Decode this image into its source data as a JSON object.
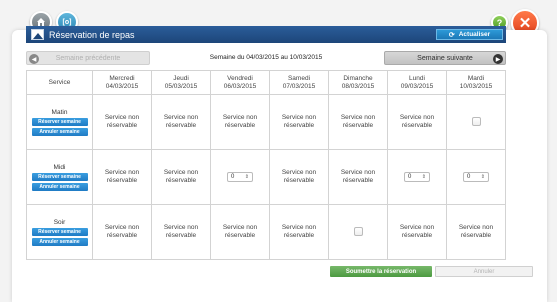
{
  "top_buttons": {
    "home_icon": "home-icon",
    "calendar_icon": "calendar-icon",
    "calendar_label": "[o]",
    "help_label": "?",
    "close_label": "✕"
  },
  "header": {
    "title": "Réservation de repas",
    "refresh_label": "Actualiser",
    "refresh_icon": "⟳"
  },
  "week_nav": {
    "prev_label": "Semaine précédente",
    "prev_arrow": "◀",
    "range_label": "Semaine du 04/03/2015 au 10/03/2015",
    "next_label": "Semaine suivante",
    "next_arrow": "▶"
  },
  "table": {
    "service_header": "Service",
    "days": [
      {
        "name": "Mercredi",
        "date": "04/03/2015"
      },
      {
        "name": "Jeudi",
        "date": "05/03/2015"
      },
      {
        "name": "Vendredi",
        "date": "06/03/2015"
      },
      {
        "name": "Samedi",
        "date": "07/03/2015"
      },
      {
        "name": "Dimanche",
        "date": "08/03/2015"
      },
      {
        "name": "Lundi",
        "date": "09/03/2015"
      },
      {
        "name": "Mardi",
        "date": "10/03/2015"
      }
    ],
    "reserve_week_label": "Réserver semaine",
    "cancel_week_label": "Annuler semaine",
    "nonres_line1": "Service non",
    "nonres_line2": "réservable",
    "spin_value": "0",
    "spin_arrows": "⇕",
    "rows": [
      {
        "label": "Matin",
        "cells": [
          "nonres",
          "nonres",
          "nonres",
          "nonres",
          "nonres",
          "nonres",
          "checkbox"
        ]
      },
      {
        "label": "Midi",
        "cells": [
          "nonres",
          "nonres",
          "spin",
          "nonres",
          "nonres",
          "spin",
          "spin"
        ]
      },
      {
        "label": "Soir",
        "cells": [
          "nonres",
          "nonres",
          "nonres",
          "nonres",
          "checkbox",
          "nonres",
          "nonres"
        ]
      }
    ]
  },
  "footer": {
    "submit_label": "Soumettre la réservation",
    "cancel_label": "Annuler"
  }
}
